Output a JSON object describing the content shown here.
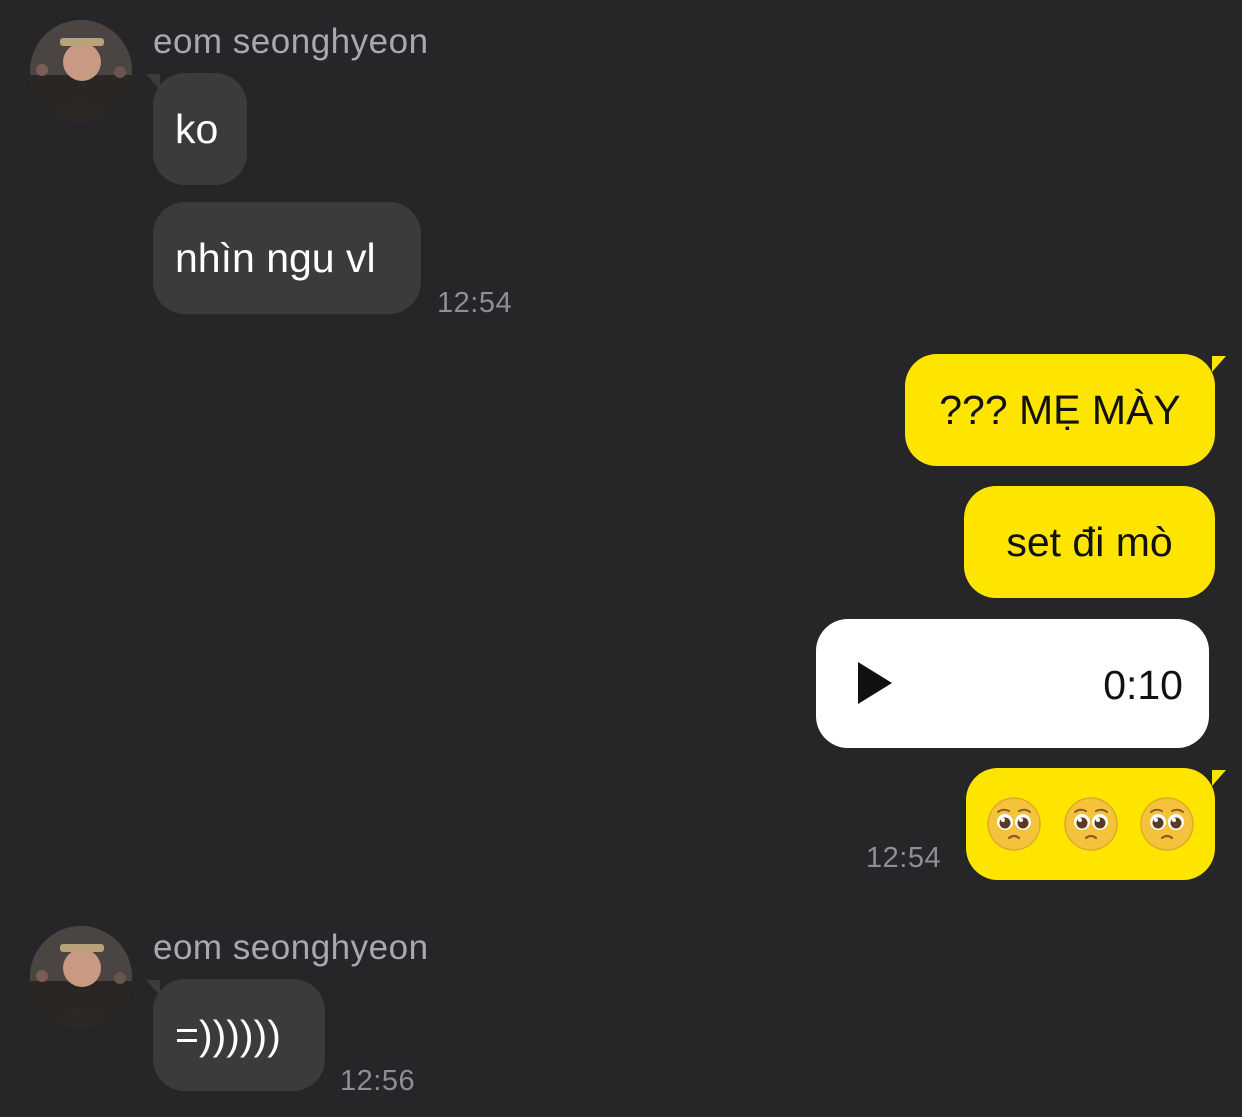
{
  "chat": {
    "group1": {
      "sender": "eom seonghyeon",
      "avatar_icon": "profile-photo-avatar",
      "messages": [
        "ko",
        "nhìn ngu vl"
      ],
      "time": "12:54"
    },
    "outgoing": {
      "messages": [
        "??? MẸ MÀY",
        "set đi mò"
      ],
      "voice": {
        "icon": "play-icon",
        "duration": "0:10"
      },
      "emoji_message": {
        "icons": [
          "pleading-face-icon",
          "pleading-face-icon",
          "pleading-face-icon"
        ]
      },
      "time": "12:54"
    },
    "group2": {
      "sender": "eom seonghyeon",
      "avatar_icon": "profile-photo-avatar",
      "messages": [
        "=))))))"
      ],
      "time": "12:56"
    }
  },
  "colors": {
    "background": "#262628",
    "incoming_bubble": "#3b3b3d",
    "outgoing_bubble": "#fee500",
    "voice_bubble": "#ffffff",
    "secondary_text": "#a9a9ad"
  }
}
